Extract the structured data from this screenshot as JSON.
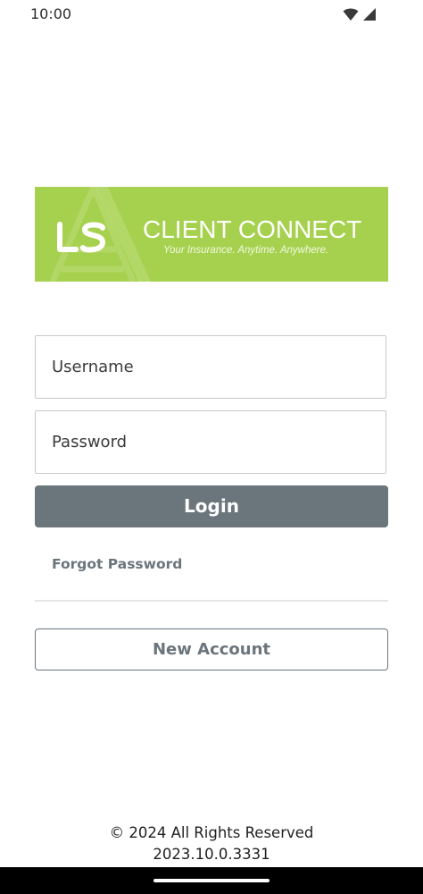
{
  "status_bar": {
    "time": "10:00",
    "icons": [
      "wifi-icon",
      "cellular-signal-icon"
    ]
  },
  "banner": {
    "logo_text": "LS",
    "title": "CLIENT CONNECT",
    "tagline": "Your Insurance. Anytime. Anywhere.",
    "background_color": "#a6d14e"
  },
  "login_form": {
    "username_placeholder": "Username",
    "password_placeholder": "Password",
    "login_label": "Login",
    "forgot_password_label": "Forgot Password",
    "new_account_label": "New Account"
  },
  "footer": {
    "copyright": "© 2024 All Rights Reserved",
    "version": "2023.10.0.3331"
  },
  "colors": {
    "primary_button": "#6b757c",
    "brand_green": "#a6d14e"
  }
}
